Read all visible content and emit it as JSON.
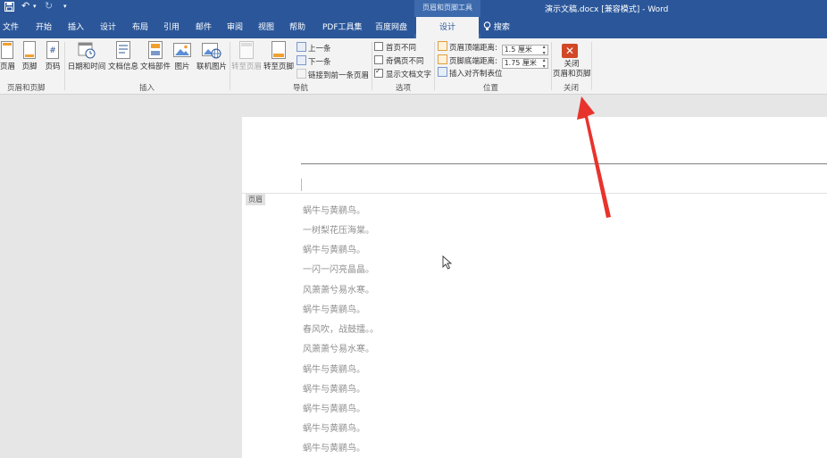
{
  "titlebar": {
    "context_tools": "页眉和页脚工具",
    "window_title": "演示文稿.docx [兼容模式] - Word",
    "save_icon": "save-icon",
    "undo_icon": "undo-icon",
    "redo_icon": "redo-icon",
    "customize_icon": "customize-icon",
    "bg": "#2b579a"
  },
  "tabs": [
    "文件",
    "开始",
    "插入",
    "设计",
    "布局",
    "引用",
    "邮件",
    "审阅",
    "视图",
    "帮助",
    "PDF工具集",
    "百度网盘",
    "设计"
  ],
  "search_label": "搜索",
  "ribbon": {
    "header_btn": "页眉",
    "footer_btn": "页脚",
    "pagenum_btn": "页码",
    "group_header_footer": "页眉和页脚",
    "datetime_btn": "日期和时间",
    "docinfo_btn": "文档信息",
    "docparts_btn": "文档部件",
    "picture_btn": "图片",
    "onlinepic_btn": "联机图片",
    "group_insert": "插入",
    "goto_header_btn": "转至页眉",
    "goto_footer_btn": "转至页脚",
    "prev_btn": "上一条",
    "next_btn": "下一条",
    "link_prev_btn": "链接到前一条页眉",
    "group_nav": "导航",
    "first_page_diff": "首页不同",
    "odd_even_diff": "奇偶页不同",
    "show_doc_text": "显示文档文字",
    "group_options": "选项",
    "header_top_label": "页眉顶端距离:",
    "header_top_value": "1.5 厘米",
    "footer_bottom_label": "页脚底端距离:",
    "footer_bottom_value": "1.75 厘米",
    "insert_align_tab": "插入对齐制表位",
    "group_position": "位置",
    "close_line1": "关闭",
    "close_line2": "页眉和页脚",
    "group_close": "关闭",
    "close_color": "#d24726"
  },
  "document": {
    "header_tag": "页眉",
    "lines": [
      "蜗牛与黄鹂鸟。",
      "一树梨花压海棠。",
      "蜗牛与黄鹂鸟。",
      "一闪一闪亮晶晶。",
      "风萧萧兮易水寒。",
      "蜗牛与黄鹂鸟。",
      "春风吹，战鼓擂。。",
      "风萧萧兮易水寒。",
      "蜗牛与黄鹂鸟。",
      "蜗牛与黄鹂鸟。",
      "蜗牛与黄鹂鸟。",
      "蜗牛与黄鹂鸟。",
      "蜗牛与黄鹂鸟。"
    ]
  },
  "annotation": {
    "color": "#e8332d"
  }
}
